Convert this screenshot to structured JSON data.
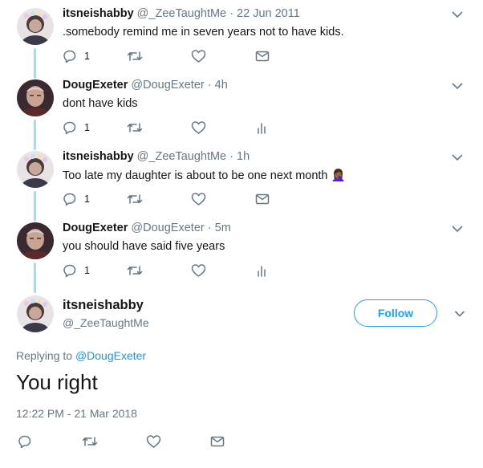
{
  "thread": [
    {
      "display_name": "itsneishabby",
      "handle": "@_ZeeTaughtMe",
      "separator": "·",
      "time": "22 Jun 2011",
      "text": ".somebody remind me in seven years not to have kids.",
      "reply_count": "1",
      "last_action_icon": "envelope-icon"
    },
    {
      "display_name": "DougExeter",
      "handle": "@DougExeter",
      "separator": "·",
      "time": "4h",
      "text": "dont have kids",
      "reply_count": "1",
      "last_action_icon": "analytics-icon"
    },
    {
      "display_name": "itsneishabby",
      "handle": "@_ZeeTaughtMe",
      "separator": "·",
      "time": "1h",
      "text": "Too late my daughter is about to be one next month",
      "emoji": "🤦🏾‍♀️",
      "reply_count": "1",
      "last_action_icon": "envelope-icon"
    },
    {
      "display_name": "DougExeter",
      "handle": "@DougExeter",
      "separator": "·",
      "time": "5m",
      "text": "you should have said five years",
      "reply_count": "1",
      "last_action_icon": "analytics-icon"
    }
  ],
  "focused": {
    "display_name": "itsneishabby",
    "handle": "@_ZeeTaughtMe",
    "follow_label": "Follow",
    "replying_prefix": "Replying to",
    "replying_handle": "@DougExeter",
    "text": "You right",
    "timestamp": "12:22 PM - 21 Mar 2018"
  },
  "colors": {
    "accent": "#1da1f2",
    "link": "#1b95e0",
    "muted": "#657786",
    "text": "#14171a",
    "thread_line": "#a8dcf2"
  }
}
